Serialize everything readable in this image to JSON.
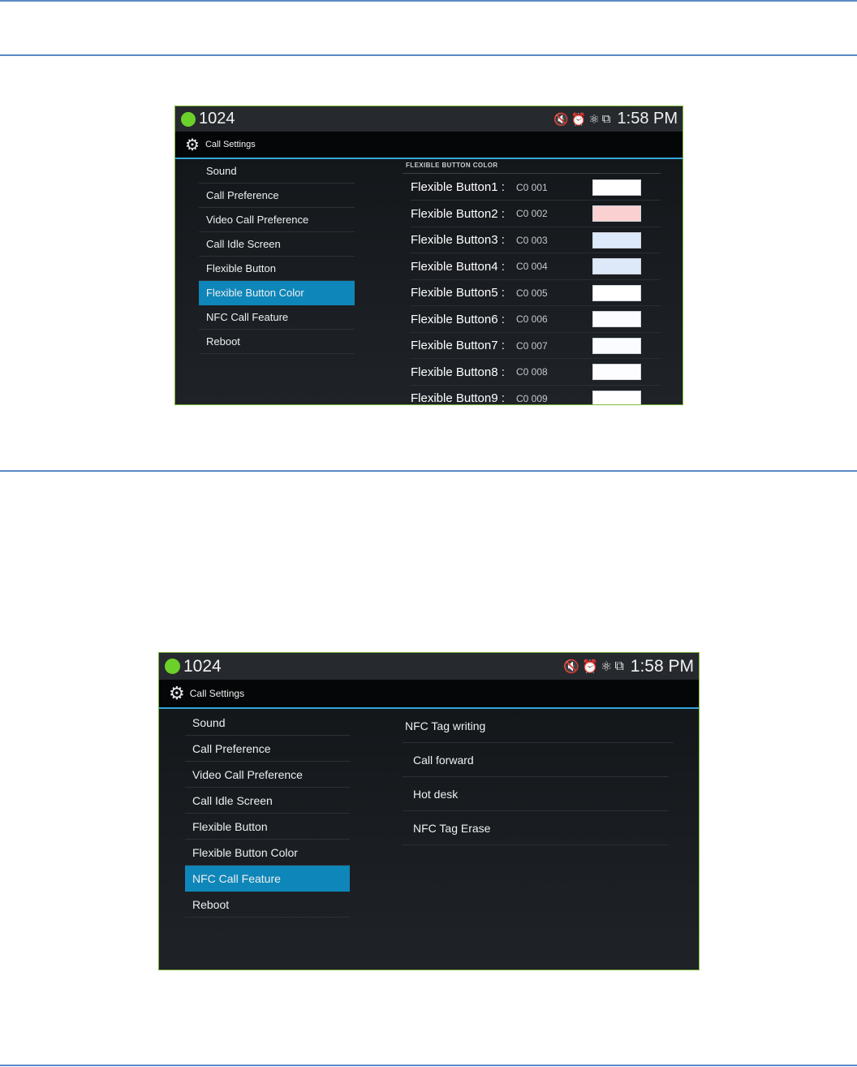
{
  "screen1": {
    "status": {
      "extension": "1024",
      "time": "1:58 PM"
    },
    "title": "Call Settings",
    "menu": [
      {
        "label": "Sound",
        "active": false
      },
      {
        "label": "Call Preference",
        "active": false
      },
      {
        "label": "Video Call Preference",
        "active": false
      },
      {
        "label": "Call Idle Screen",
        "active": false
      },
      {
        "label": "Flexible Button",
        "active": false
      },
      {
        "label": "Flexible Button Color",
        "active": true
      },
      {
        "label": "NFC Call Feature",
        "active": false
      },
      {
        "label": "Reboot",
        "active": false
      }
    ],
    "section_header": "FLEXIBLE BUTTON COLOR",
    "buttons": [
      {
        "label": "Flexible Button1 :",
        "code": "C0 001",
        "color": "#ffffff"
      },
      {
        "label": "Flexible Button2 :",
        "code": "C0 002",
        "color": "#fbd0d0"
      },
      {
        "label": "Flexible Button3 :",
        "code": "C0 003",
        "color": "#dbe9fb"
      },
      {
        "label": "Flexible Button4 :",
        "code": "C0 004",
        "color": "#dde9f8"
      },
      {
        "label": "Flexible Button5 :",
        "code": "C0 005",
        "color": "#ffffff"
      },
      {
        "label": "Flexible Button6 :",
        "code": "C0 006",
        "color": "#fbfcff"
      },
      {
        "label": "Flexible Button7 :",
        "code": "C0 007",
        "color": "#fbfcff"
      },
      {
        "label": "Flexible Button8 :",
        "code": "C0 008",
        "color": "#fdfdff"
      },
      {
        "label": "Flexible Button9 :",
        "code": "C0 009",
        "color": "#ffffff"
      }
    ]
  },
  "screen2": {
    "status": {
      "extension": "1024",
      "time": "1:58 PM"
    },
    "title": "Call Settings",
    "menu": [
      {
        "label": "Sound",
        "active": false
      },
      {
        "label": "Call Preference",
        "active": false
      },
      {
        "label": "Video Call Preference",
        "active": false
      },
      {
        "label": "Call Idle Screen",
        "active": false
      },
      {
        "label": "Flexible Button",
        "active": false
      },
      {
        "label": "Flexible Button Color",
        "active": false
      },
      {
        "label": "NFC Call Feature",
        "active": true
      },
      {
        "label": "Reboot",
        "active": false
      }
    ],
    "nfc_header": "NFC Tag writing",
    "nfc_items": [
      "Call forward",
      "Hot desk",
      "NFC Tag Erase"
    ]
  },
  "icons": [
    "presence-dot",
    "mute-icon",
    "alarm-icon",
    "network-icon",
    "screenshot-icon",
    "gear-icon"
  ],
  "colors": {
    "accent": "#0f86b9",
    "presence": "#6cd02a",
    "divider": "#33a6d8",
    "rule": "#5b8ac6"
  }
}
